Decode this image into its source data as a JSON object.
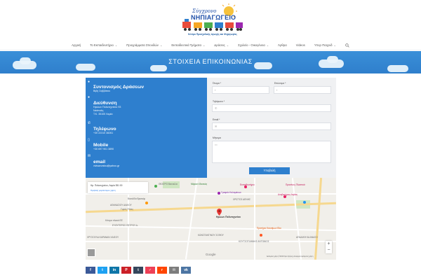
{
  "logo": {
    "script_text": "Σύγχρονο",
    "main_text": "ΝΗΠΙΑΓΩΓΕΙΟ",
    "subtitle": "Κέντρο Προσχολικής Αγωγής και Ψυχαγωγίας"
  },
  "nav": {
    "items": [
      {
        "label": "Αρχική",
        "caret": false
      },
      {
        "label": "Το Εκπαιδευτήριο",
        "caret": true
      },
      {
        "label": "Προγράμματα Σπουδών",
        "caret": true
      },
      {
        "label": "Εκπαιδευτικά Τμήματα",
        "caret": true
      },
      {
        "label": "Δράσεις",
        "caret": true
      },
      {
        "label": "Σχολείο - Οικογένεια",
        "caret": true
      },
      {
        "label": "Άρθρα",
        "caret": false
      },
      {
        "label": "Videos",
        "caret": false
      },
      {
        "label": "Υπερ Παιχνιδ",
        "caret": true
      }
    ],
    "search_icon": "search-icon"
  },
  "banner": {
    "title": "ΣΤΟΙΧΕΙΑ ΕΠΙΚΟΙΝΩΝΙΑΣ",
    "color": "#2f80cf"
  },
  "contact": {
    "color": "#2e7fce",
    "groups": [
      {
        "icon": "person-icon",
        "heading": "Συντονισμός Δράσεων",
        "lines": [
          "Βιβή Σαββάτου"
        ]
      },
      {
        "icon": "location-icon",
        "heading": "Διεύθυνση",
        "lines": [
          "Ηρώων Πολυτεχνείου 93",
          "Νεάπολη",
          "Τ.Κ. 35100 Λαμία"
        ]
      },
      {
        "icon": "phone-icon",
        "heading": "Τηλέφωνο",
        "lines": [
          "+30 22310 38261"
        ]
      },
      {
        "icon": "mobile-icon",
        "heading": "Mobile",
        "lines": [
          "+30 697 901 3890"
        ]
      },
      {
        "icon": "email-icon",
        "heading": "email",
        "lines": [
          "vivisavvatou@yahoo.gr"
        ]
      }
    ]
  },
  "form": {
    "first_name_label": "Όνομα *",
    "last_name_label": "Επώνυμο *",
    "phone_label": "Τηλέφωνο *",
    "email_label": "Email *",
    "message_label": "Μήνυμα",
    "submit_label": "Υποβολή"
  },
  "map": {
    "address": "Ηρ. Πολυτεχνείου, Λαμία 351 00",
    "larger_map_link": "Προβολή μεγαλύτερου χάρτη",
    "pin_label": "Ηρώων Πολυτεχνείου",
    "labels": [
      "ΘΕΑΤΡΟ Βιενούλα",
      "Μάρκετ Ιδανικός",
      "Εκπαιδευτήριο",
      "Πρασίνος-Πλαστικά",
      "Αναβατήρας Λαμίας",
      "Γραφείο Καλαμάκων",
      "ΧΡΙΣΤΟΣ ΔΕΝΗΣ",
      "Βασιλίδα Βρισκόμ",
      "ΑΘΑΝΑΣΙΟΥ ΔΙΑΚΟΥ",
      "Γυρός Πίττες",
      "Κτίσμα πλακά ΕΕ",
      "ΕΥΘΥΤΕΡΟΣ ΠΕΤΡΟΥ Δ.",
      "Πρατήριο Καυσίμων Eko",
      "ΚΩΝΣΤΑΝΤΙΝΟΥ ΣΟΦΟΥ",
      "ΧΡΥΣΟΥΛΑ ΚΑΡΑΝΑΝ ΧΑΙΣΟΥ",
      "ΑΠΑΔΙΚΗ ΚΑ ΑΝΑΣΟ",
      "ΚΟΥΤΣΟΓΙΑΝΝΗΣ ΑΝΤΩΝΙΟΣ"
    ],
    "google_text": "Google",
    "footer_text": "Δεδομένα χάρτη ©2019   Όροι Χρήσης   Αναφορά σφάλματος χάρτη",
    "zoom_in": "+",
    "zoom_out": "−"
  },
  "share": {
    "buttons": [
      {
        "name": "facebook-share-button",
        "icon": "facebook-icon",
        "glyph": "f",
        "color": "#3b5998"
      },
      {
        "name": "twitter-share-button",
        "icon": "twitter-icon",
        "glyph": "t",
        "color": "#1da1f2"
      },
      {
        "name": "linkedin-share-button",
        "icon": "linkedin-icon",
        "glyph": "in",
        "color": "#0e76a8"
      },
      {
        "name": "pinterest-share-button",
        "icon": "pinterest-icon",
        "glyph": "P",
        "color": "#cb2027"
      },
      {
        "name": "tumblr-share-button",
        "icon": "tumblr-icon",
        "glyph": "t",
        "color": "#35465c"
      },
      {
        "name": "pocket-share-button",
        "icon": "pocket-icon",
        "glyph": "✓",
        "color": "#ee4056"
      },
      {
        "name": "reddit-share-button",
        "icon": "reddit-icon",
        "glyph": "r",
        "color": "#ff4500"
      },
      {
        "name": "email-share-button",
        "icon": "mail-icon",
        "glyph": "✉",
        "color": "#7d7d7d"
      },
      {
        "name": "vk-share-button",
        "icon": "vk-icon",
        "glyph": "vk",
        "color": "#4c75a3"
      }
    ]
  }
}
